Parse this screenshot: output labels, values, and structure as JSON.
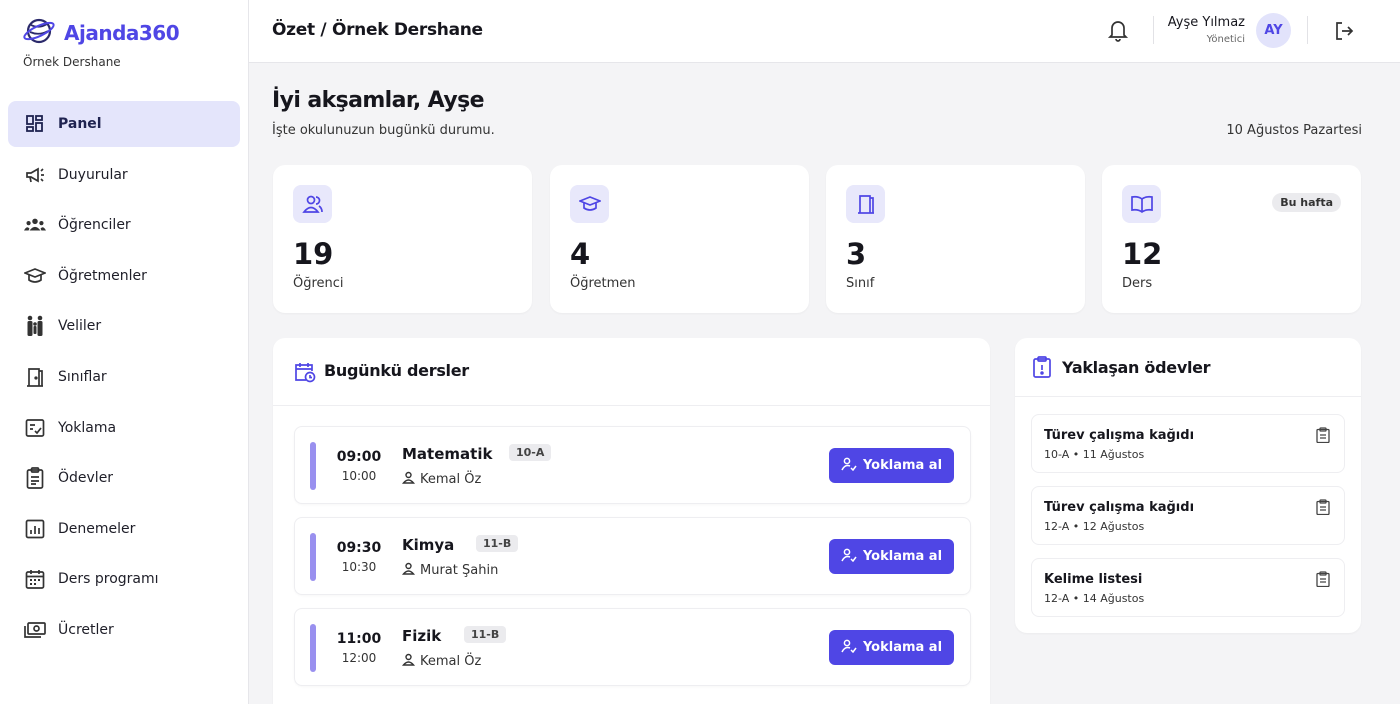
{
  "brand": {
    "name": "Ajanda360",
    "org": "Örnek Dershane"
  },
  "sidebar": {
    "items": [
      {
        "label": "Panel",
        "icon": "dashboard-icon",
        "active": true
      },
      {
        "label": "Duyurular",
        "icon": "megaphone-icon"
      },
      {
        "label": "Öğrenciler",
        "icon": "users-icon"
      },
      {
        "label": "Öğretmenler",
        "icon": "graduation-cap-icon"
      },
      {
        "label": "Veliler",
        "icon": "family-icon"
      },
      {
        "label": "Sınıflar",
        "icon": "door-icon"
      },
      {
        "label": "Yoklama",
        "icon": "checklist-icon"
      },
      {
        "label": "Ödevler",
        "icon": "clipboard-icon"
      },
      {
        "label": "Denemeler",
        "icon": "bar-chart-icon"
      },
      {
        "label": "Ders programı",
        "icon": "calendar-icon"
      },
      {
        "label": "Ücretler",
        "icon": "money-icon"
      }
    ]
  },
  "header": {
    "breadcrumb": "Özet / Örnek Dershane",
    "user_name": "Ayşe Yılmaz",
    "user_role": "Yönetici",
    "avatar": "AY"
  },
  "greeting": {
    "title": "İyi akşamlar, Ayşe",
    "subtitle": "İşte okulunuzun bugünkü durumu.",
    "date": "10 Ağustos Pazartesi"
  },
  "stats": [
    {
      "value": "19",
      "label": "Öğrenci",
      "icon": "users-icon"
    },
    {
      "value": "4",
      "label": "Öğretmen",
      "icon": "graduation-cap-icon"
    },
    {
      "value": "3",
      "label": "Sınıf",
      "icon": "door-icon"
    },
    {
      "value": "12",
      "label": "Ders",
      "icon": "book-icon",
      "badge": "Bu hafta"
    }
  ],
  "today": {
    "title": "Bugünkü dersler",
    "lessons": [
      {
        "start": "09:00",
        "end": "10:00",
        "subject": "Matematik",
        "class": "10-A",
        "teacher": "Kemal Öz",
        "button": "Yoklama al"
      },
      {
        "start": "09:30",
        "end": "10:30",
        "subject": "Kimya",
        "class": "11-B",
        "teacher": "Murat Şahin",
        "button": "Yoklama al"
      },
      {
        "start": "11:00",
        "end": "12:00",
        "subject": "Fizik",
        "class": "11-B",
        "teacher": "Kemal Öz",
        "button": "Yoklama al"
      }
    ]
  },
  "homework": {
    "title": "Yaklaşan ödevler",
    "items": [
      {
        "title": "Türev çalışma kağıdı",
        "meta": "10-A • 11 Ağustos"
      },
      {
        "title": "Türev çalışma kağıdı",
        "meta": "12-A • 12 Ağustos"
      },
      {
        "title": "Kelime listesi",
        "meta": "12-A • 14 Ağustos"
      }
    ]
  },
  "colors": {
    "accent": "#4f46e5",
    "active_bg": "#e4e5fb",
    "lesson_bar": "#9990ef"
  }
}
